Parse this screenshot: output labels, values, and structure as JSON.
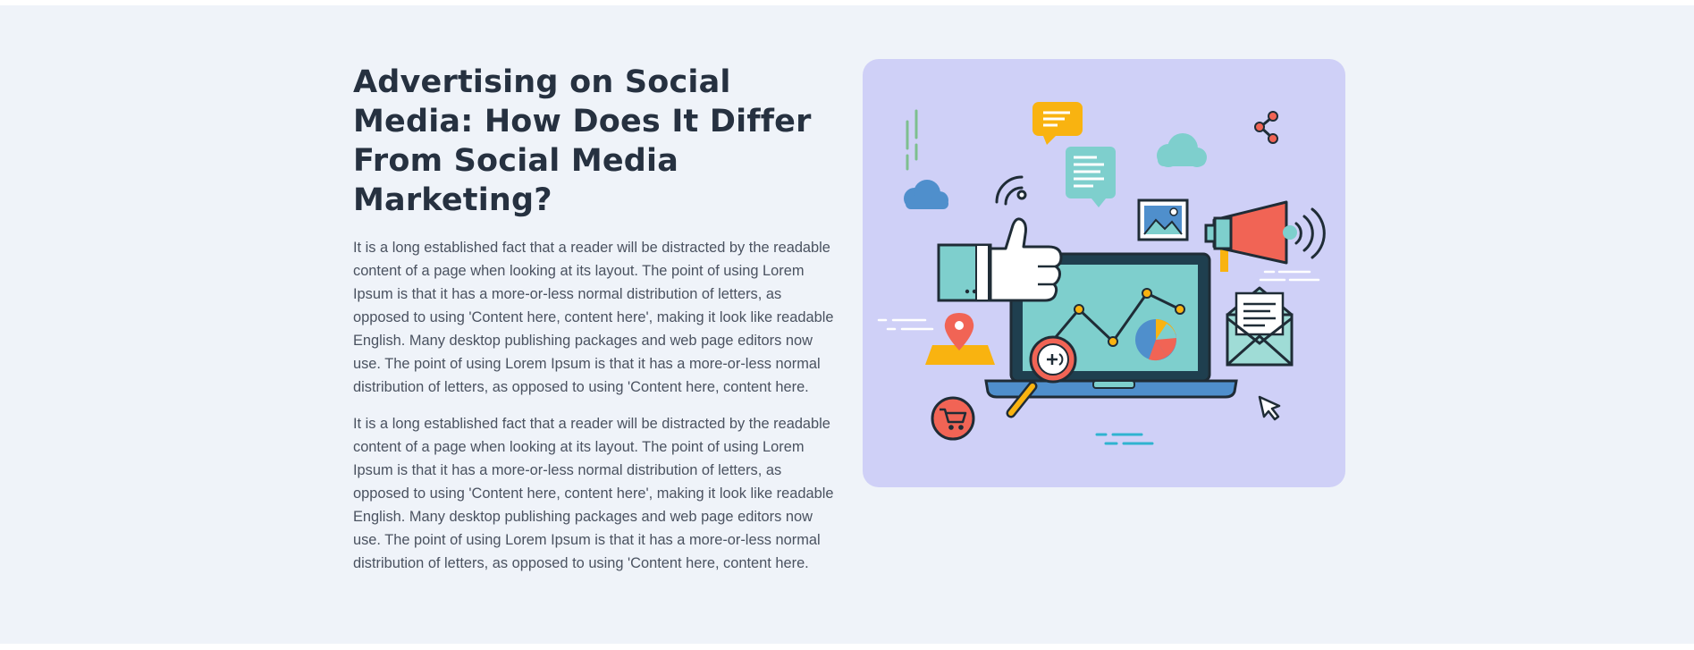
{
  "article": {
    "title": "Advertising on Social Media: How Does It Differ From Social Media Marketing?",
    "paragraphs": [
      "It is a long established fact that a reader will be distracted by the readable content of a page when looking at its layout. The point of using Lorem Ipsum is that it has a more-or-less normal distribution of letters, as opposed to using 'Content here, content here', making it look like readable English. Many desktop publishing packages and web page editors now use. The point of using Lorem Ipsum is that it has a more-or-less normal distribution of letters, as opposed to using 'Content here, content here.",
      "It is a long established fact that a reader will be distracted by the readable content of a page when looking at its layout. The point of using Lorem Ipsum is that it has a more-or-less normal distribution of letters, as opposed to using 'Content here, content here', making it look like readable English. Many desktop publishing packages and web page editors now use. The point of using Lorem Ipsum is that it has a more-or-less normal distribution of letters, as opposed to using 'Content here, content here."
    ]
  },
  "illustration": {
    "background": "#cfd0f7",
    "icons": [
      "thumbs-up-icon",
      "laptop-icon",
      "megaphone-icon",
      "magnifier-icon",
      "envelope-icon",
      "cloud-icon",
      "chat-bubble-icon",
      "share-icon",
      "map-pin-icon",
      "shopping-cart-icon",
      "cursor-icon",
      "pie-chart-icon",
      "wifi-icon",
      "picture-icon"
    ]
  },
  "colors": {
    "page_background": "#eff3f9",
    "heading": "#263140",
    "body_text": "#4a5260",
    "teal": "#7ecfcd",
    "coral": "#f16455",
    "yellow": "#f9b310",
    "blue": "#4f8fcc",
    "dark": "#1f2c36"
  }
}
